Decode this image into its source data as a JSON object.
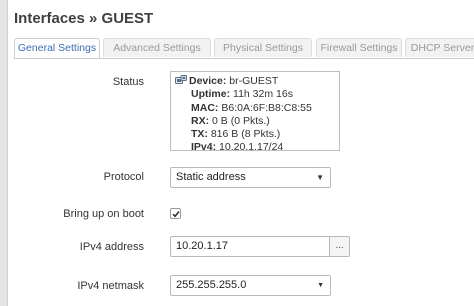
{
  "page": {
    "title": "Interfaces » GUEST"
  },
  "tabs": [
    {
      "label": "General Settings",
      "active": true
    },
    {
      "label": "Advanced Settings",
      "active": false
    },
    {
      "label": "Physical Settings",
      "active": false
    },
    {
      "label": "Firewall Settings",
      "active": false
    },
    {
      "label": "DHCP Server",
      "active": false
    }
  ],
  "status": {
    "label": "Status",
    "device_key": "Device:",
    "device_val": "br-GUEST",
    "uptime_key": "Uptime:",
    "uptime_val": "11h 32m 16s",
    "mac_key": "MAC:",
    "mac_val": "B6:0A:6F:B8:C8:55",
    "rx_key": "RX:",
    "rx_val": "0 B (0 Pkts.)",
    "tx_key": "TX:",
    "tx_val": "816 B (8 Pkts.)",
    "ipv4_key": "IPv4:",
    "ipv4_val": "10.20.1.17/24"
  },
  "protocol": {
    "label": "Protocol",
    "value": "Static address"
  },
  "bring_up": {
    "label": "Bring up on boot",
    "checked": true
  },
  "ipv4_address": {
    "label": "IPv4 address",
    "value": "10.20.1.17",
    "button": "..."
  },
  "ipv4_netmask": {
    "label": "IPv4 netmask",
    "value": "255.255.255.0"
  },
  "colors": {
    "active_tab": "#3a6fb0",
    "inactive_tab": "#999999",
    "border": "#cccccc"
  },
  "icons": {
    "device": "ethernet-port-icon",
    "dropdown": "caret-down-icon",
    "checkbox": "checkmark-icon"
  }
}
